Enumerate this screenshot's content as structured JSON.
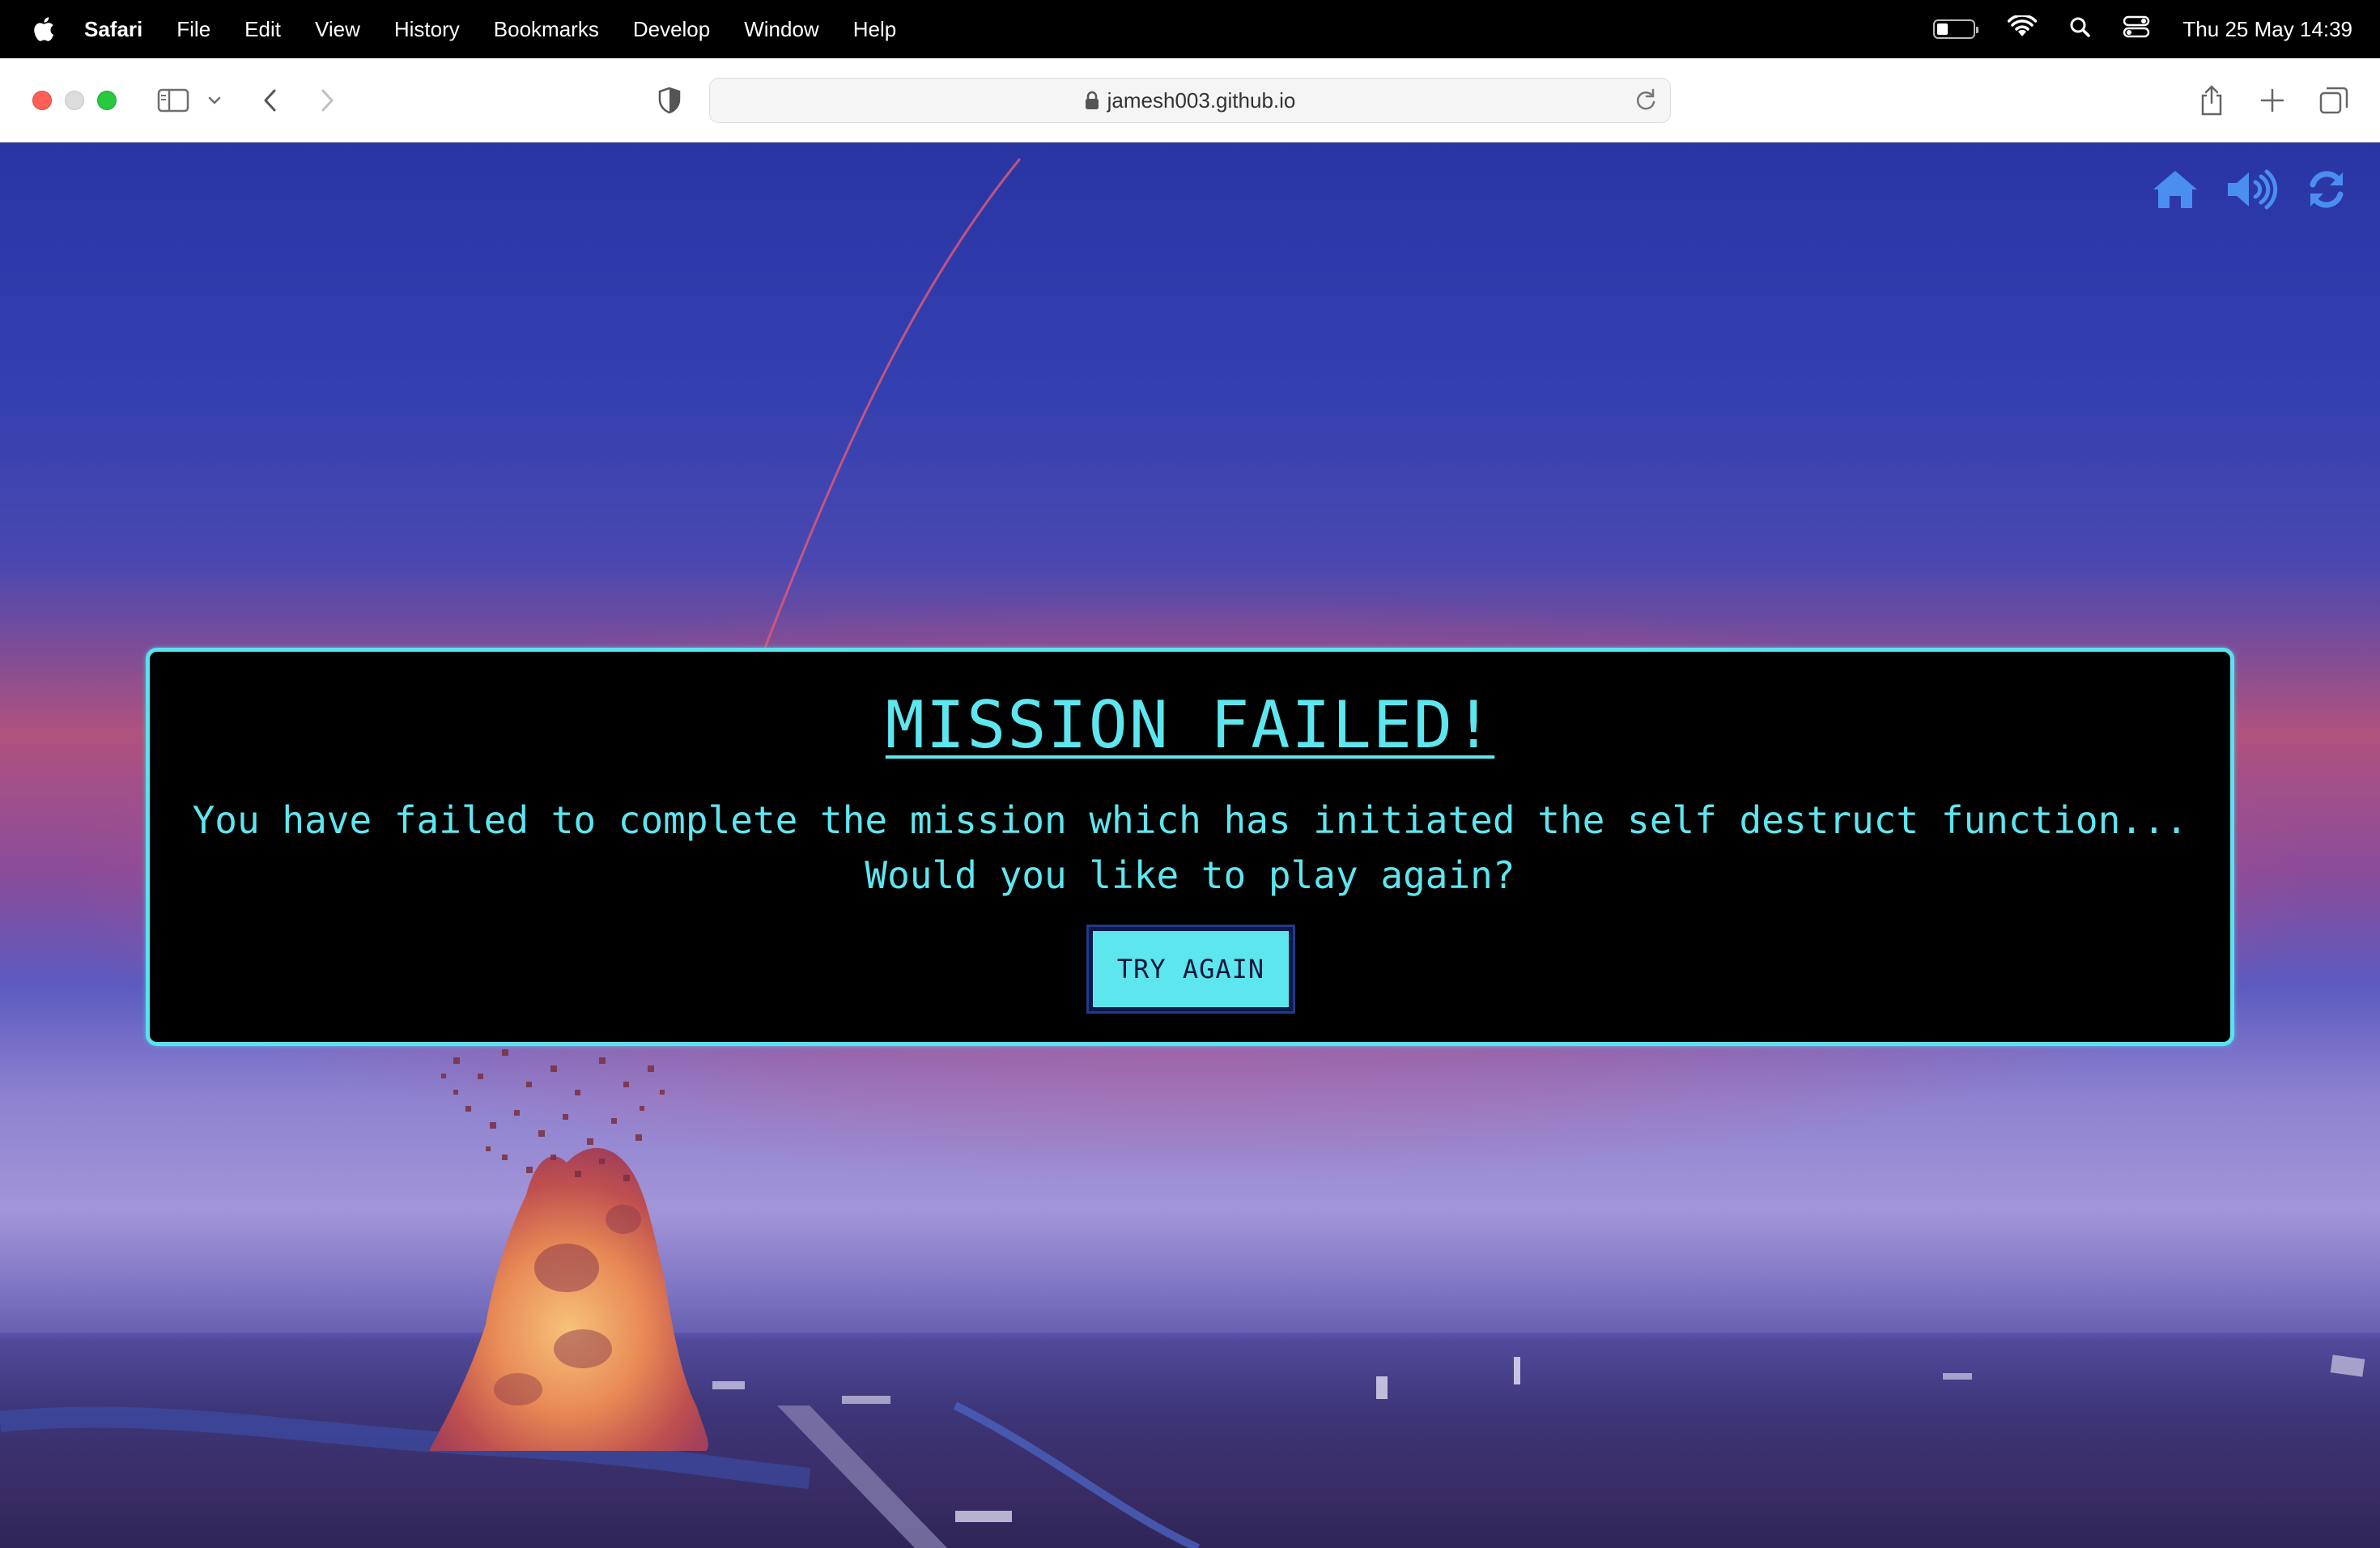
{
  "menubar": {
    "app_name": "Safari",
    "items": [
      "File",
      "Edit",
      "View",
      "History",
      "Bookmarks",
      "Develop",
      "Window",
      "Help"
    ],
    "clock": "Thu 25 May  14:39",
    "battery_level": 0.3
  },
  "browser": {
    "url": "jamesh003.github.io"
  },
  "game": {
    "hud": {
      "icons": [
        "home-icon",
        "volume-icon",
        "refresh-icon"
      ],
      "color": "#4a8ef0"
    },
    "modal": {
      "title": "MISSION FAILED!",
      "line1": "You have failed to complete the mission which has initiated the self destruct function...",
      "line2": "Would you like to play again?",
      "button_label": "TRY AGAIN",
      "accent_color": "#5ee6ef"
    }
  }
}
